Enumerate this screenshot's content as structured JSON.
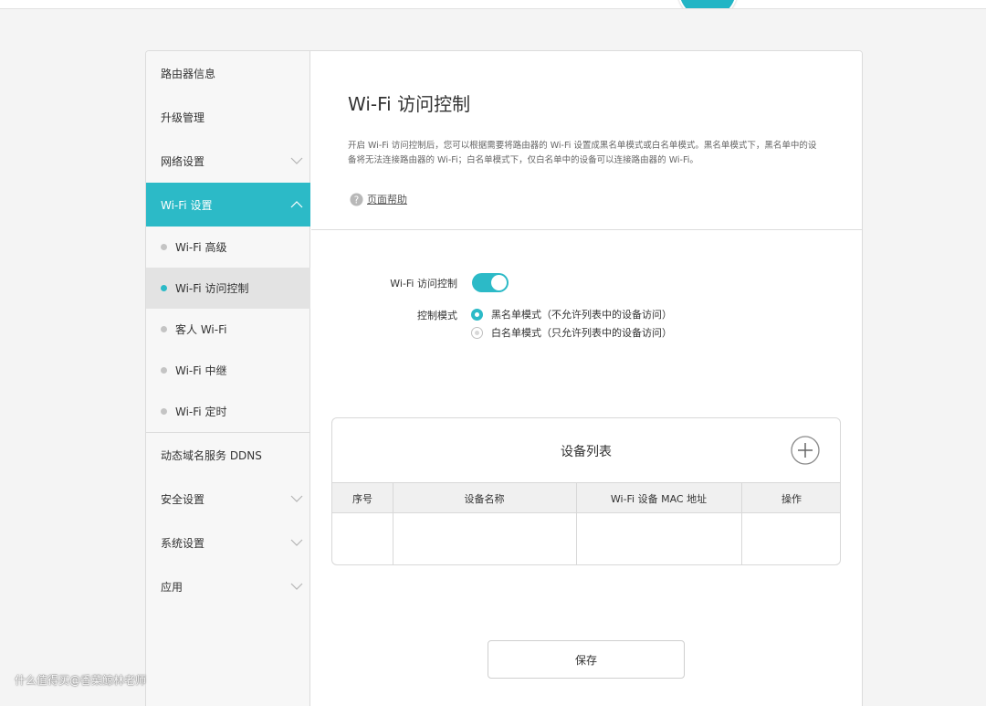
{
  "sidebar": {
    "items": [
      {
        "label": "路由器信息"
      },
      {
        "label": "升级管理"
      },
      {
        "label": "网络设置"
      },
      {
        "label": "Wi-Fi 设置"
      },
      {
        "label": "动态域名服务 DDNS"
      },
      {
        "label": "安全设置"
      },
      {
        "label": "系统设置"
      },
      {
        "label": "应用"
      }
    ],
    "wifi_sub": [
      {
        "label": "Wi-Fi 高级"
      },
      {
        "label": "Wi-Fi 访问控制"
      },
      {
        "label": "客人 Wi-Fi"
      },
      {
        "label": "Wi-Fi 中继"
      },
      {
        "label": "Wi-Fi 定时"
      }
    ]
  },
  "main": {
    "title": "Wi-Fi 访问控制",
    "description": "开启 Wi-Fi 访问控制后，您可以根据需要将路由器的 Wi-Fi 设置成黑名单模式或白名单模式。黑名单模式下，黑名单中的设备将无法连接路由器的 Wi-Fi；白名单模式下，仅白名单中的设备可以连接路由器的 Wi-Fi。",
    "help_label": "页面帮助",
    "toggle_label": "Wi-Fi 访问控制",
    "toggle_on": true,
    "mode_label": "控制模式",
    "mode_options": [
      {
        "label": "黑名单模式（不允许列表中的设备访问）",
        "selected": true
      },
      {
        "label": "白名单模式（只允许列表中的设备访问）",
        "selected": false
      }
    ],
    "device_list": {
      "title": "设备列表",
      "columns": [
        "序号",
        "设备名称",
        "Wi-Fi 设备 MAC 地址",
        "操作"
      ],
      "rows": []
    },
    "save_label": "保存"
  },
  "watermark": "什么值得买@香菜鲸林老师",
  "colors": {
    "accent": "#2cbac7",
    "background": "#f4f4f4"
  }
}
